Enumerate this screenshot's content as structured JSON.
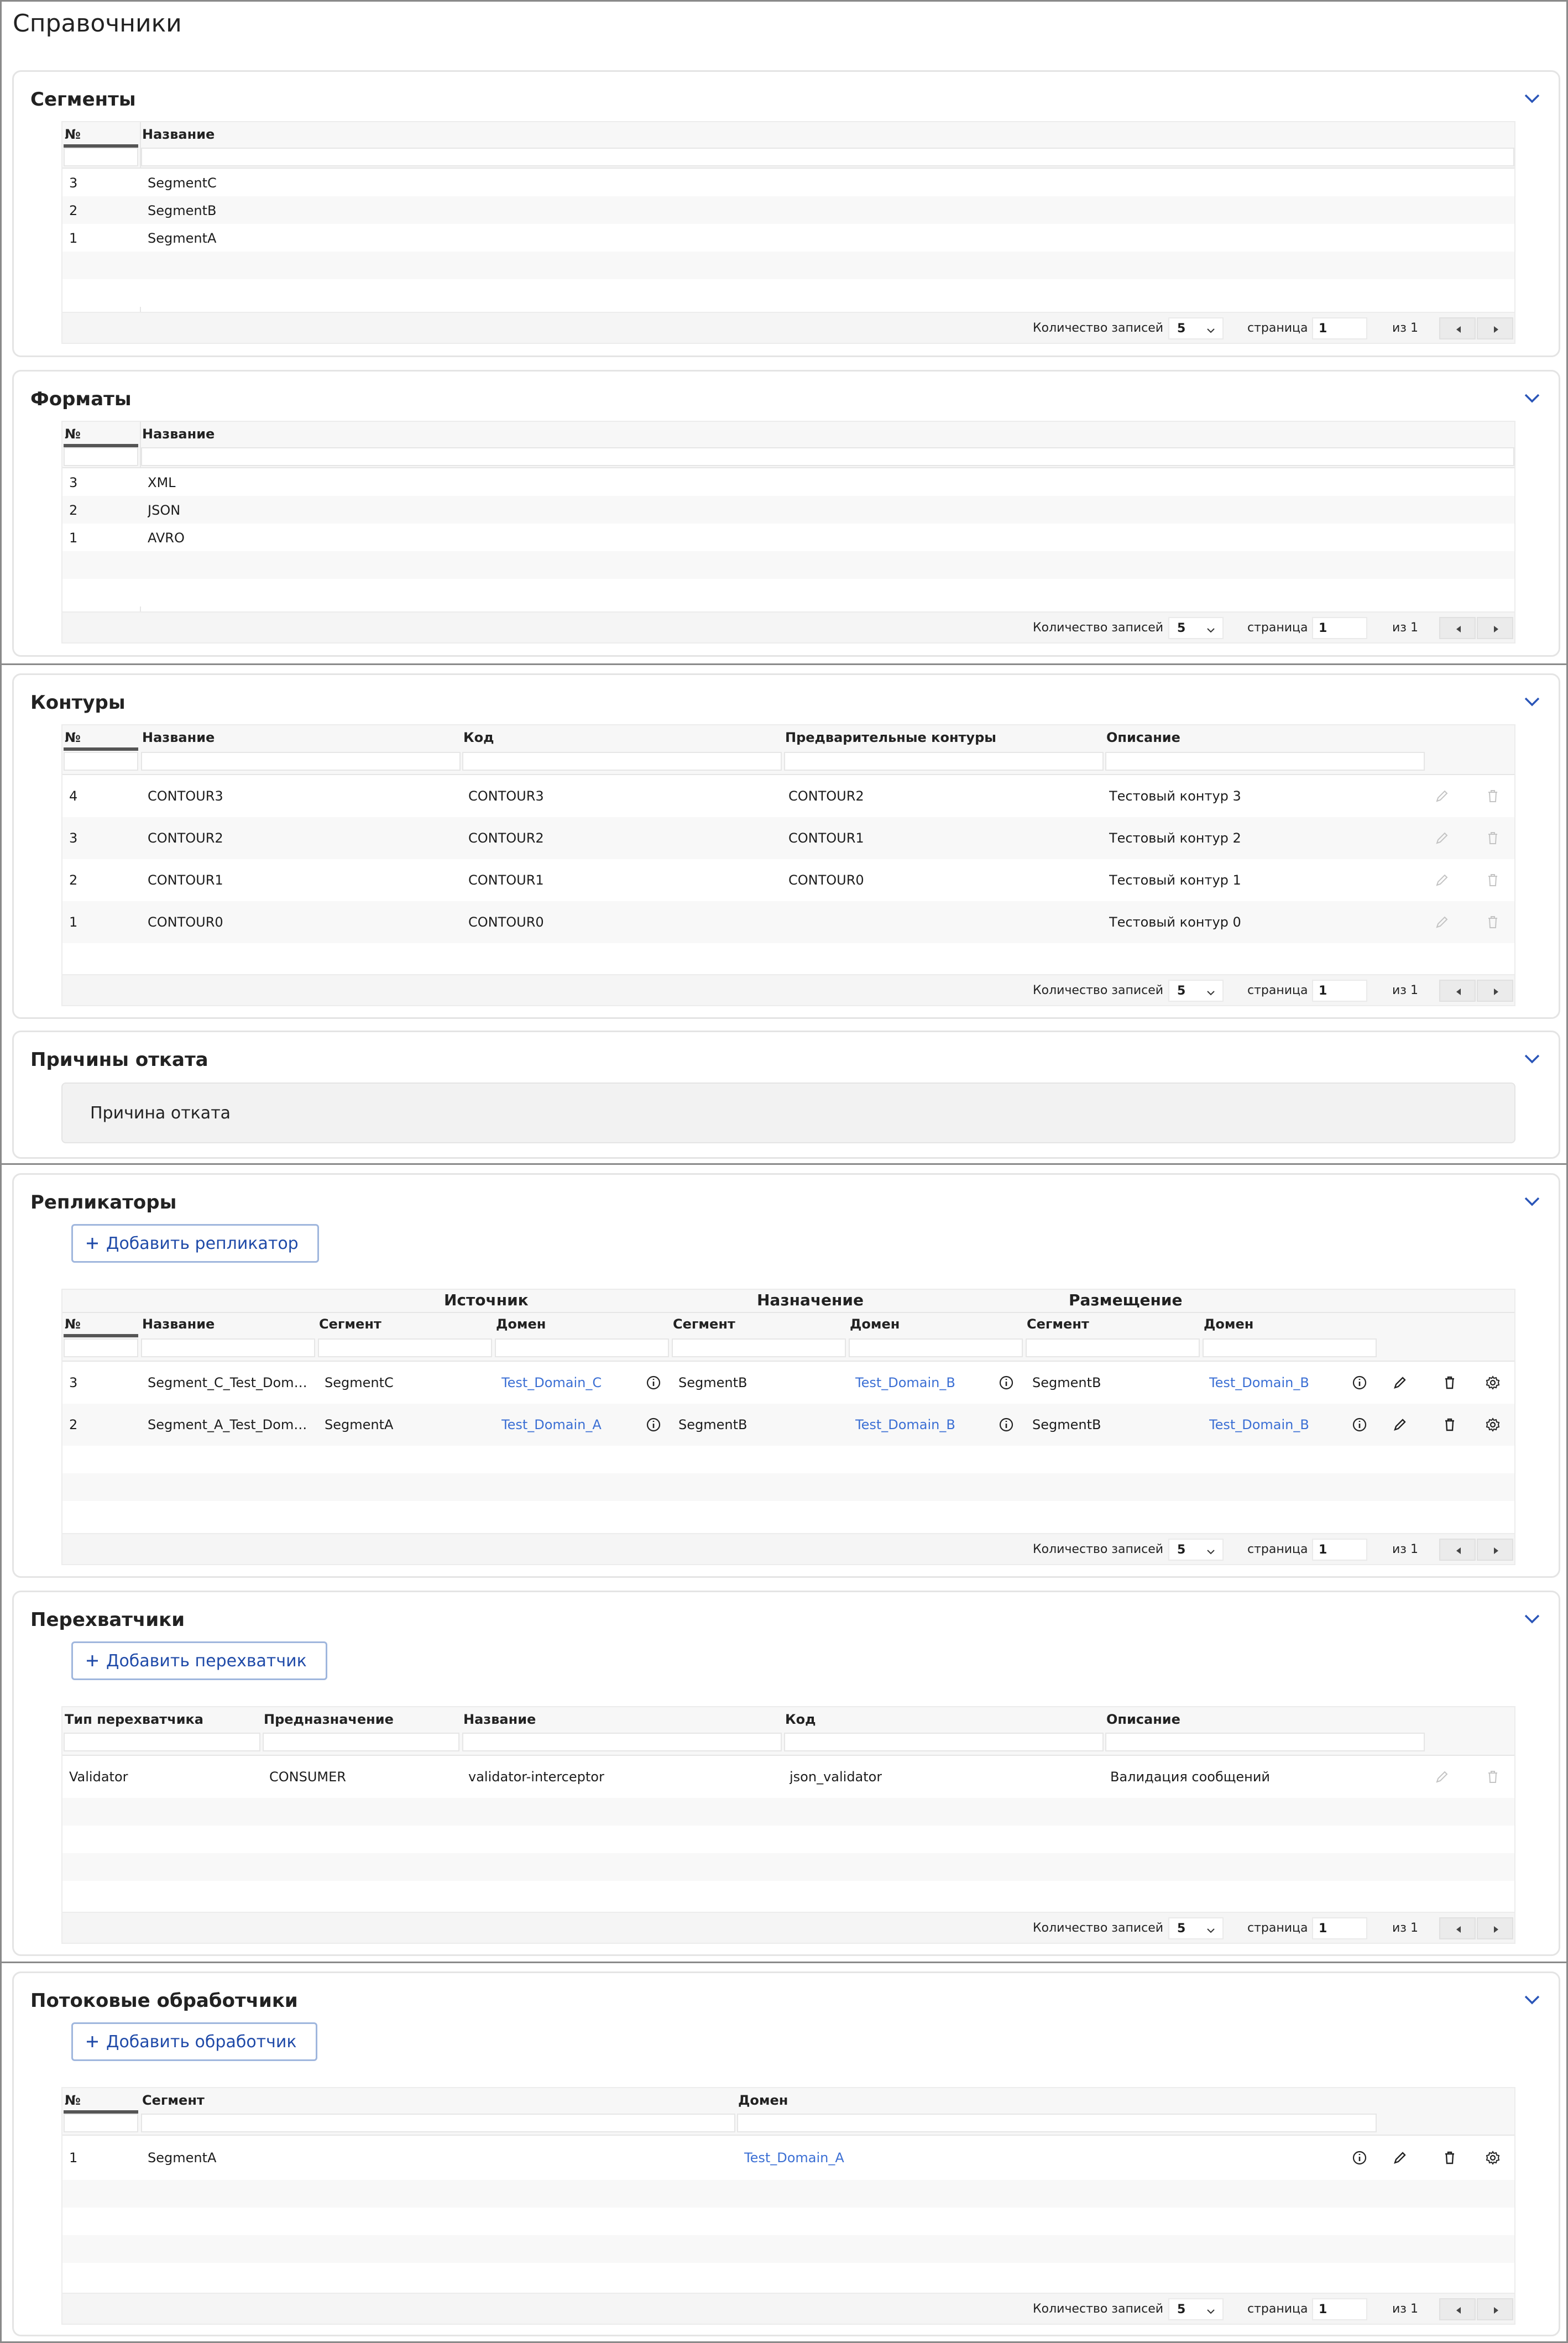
{
  "page": {
    "title": "Справочники"
  },
  "footer": {
    "count_label": "Количество записей",
    "page_size": "5",
    "page_label": "страница",
    "page": "1",
    "of_label": "из 1"
  },
  "segments": {
    "title": "Сегменты",
    "columns": [
      "№",
      "Название"
    ],
    "rows": [
      [
        "3",
        "SegmentC"
      ],
      [
        "2",
        "SegmentB"
      ],
      [
        "1",
        "SegmentA"
      ]
    ]
  },
  "formats": {
    "title": "Форматы",
    "columns": [
      "№",
      "Название"
    ],
    "rows": [
      [
        "3",
        "XML"
      ],
      [
        "2",
        "JSON"
      ],
      [
        "1",
        "AVRO"
      ]
    ]
  },
  "contours": {
    "title": "Контуры",
    "columns": [
      "№",
      "Название",
      "Код",
      "Предварительные контуры",
      "Описание"
    ],
    "rows": [
      [
        "4",
        "CONTOUR3",
        "CONTOUR3",
        "CONTOUR2",
        "Тестовый контур 3"
      ],
      [
        "3",
        "CONTOUR2",
        "CONTOUR2",
        "CONTOUR1",
        "Тестовый контур 2"
      ],
      [
        "2",
        "CONTOUR1",
        "CONTOUR1",
        "CONTOUR0",
        "Тестовый контур 1"
      ],
      [
        "1",
        "CONTOUR0",
        "CONTOUR0",
        "",
        "Тестовый контур 0"
      ]
    ]
  },
  "rollback": {
    "title": "Причины отката",
    "item": "Причина отката"
  },
  "replicators": {
    "title": "Репликаторы",
    "add_label": "Добавить репликатор",
    "groups": [
      "Источник",
      "Назначение",
      "Размещение"
    ],
    "columns": [
      "№",
      "Название",
      "Сегмент",
      "Домен",
      "Сегмент",
      "Домен",
      "Сегмент",
      "Домен"
    ],
    "rows": [
      [
        "3",
        "Segment_C_Test_Doma...",
        "SegmentC",
        "Test_Domain_C",
        "SegmentB",
        "Test_Domain_B",
        "SegmentB",
        "Test_Domain_B"
      ],
      [
        "2",
        "Segment_A_Test_Doma...",
        "SegmentA",
        "Test_Domain_A",
        "SegmentB",
        "Test_Domain_B",
        "SegmentB",
        "Test_Domain_B"
      ]
    ]
  },
  "interceptors": {
    "title": "Перехватчики",
    "add_label": "Добавить перехватчик",
    "columns": [
      "Тип перехватчика",
      "Предназначение",
      "Название",
      "Код",
      "Описание"
    ],
    "rows": [
      [
        "Validator",
        "CONSUMER",
        "validator-interceptor",
        "json_validator",
        "Валидация сообщений"
      ]
    ]
  },
  "stream": {
    "title": "Потоковые обработчики",
    "add_label": "Добавить обработчик",
    "columns": [
      "№",
      "Сегмент",
      "Домен"
    ],
    "rows": [
      [
        "1",
        "SegmentA",
        "Test_Domain_A"
      ]
    ]
  },
  "colors": {
    "link": "#3b6fd4",
    "button_text": "#1f4aa8",
    "chevron": "#2a55b8"
  }
}
